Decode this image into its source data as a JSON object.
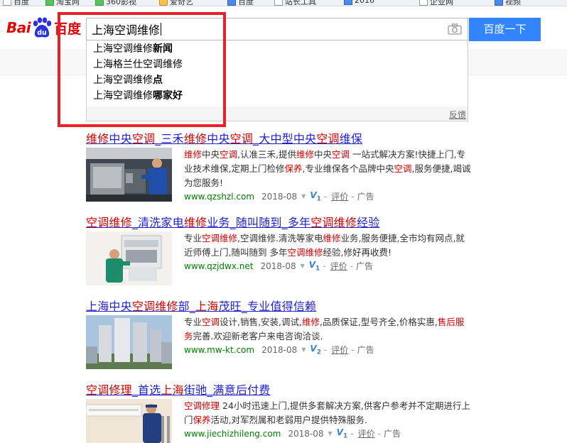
{
  "bookmarks": [
    "百度",
    "淘宝网",
    "360影视",
    "爱奇艺",
    "百度",
    "站长工具",
    "2016",
    "企业网",
    "视频"
  ],
  "logo": {
    "text_left": "Bai",
    "paw_text": "du",
    "text_right": "百度"
  },
  "search": {
    "query": "上海空调维修",
    "button_label": "百度一下"
  },
  "suggestions": [
    {
      "prefix": "上海空调维修",
      "bold": "新闻"
    },
    {
      "prefix": "上海格兰仕空调维修",
      "bold": ""
    },
    {
      "prefix": "上海空调维修",
      "bold": "点"
    },
    {
      "prefix": "上海空调维修",
      "bold": "哪家好"
    }
  ],
  "suggest_feedback": "反馈",
  "results": [
    {
      "title": [
        [
          "维修",
          1
        ],
        [
          "中央",
          0
        ],
        [
          "空调",
          1
        ],
        [
          "_三禾",
          0
        ],
        [
          "维修",
          1
        ],
        [
          "中央",
          0
        ],
        [
          "空调",
          1
        ],
        [
          "_大中型中央",
          0
        ],
        [
          "空调",
          1
        ],
        [
          "维保",
          0
        ]
      ],
      "abstract": [
        [
          "维修",
          1
        ],
        [
          "中央",
          0
        ],
        [
          "空调",
          1
        ],
        [
          ",认准三禾,提供",
          0
        ],
        [
          "维修",
          1
        ],
        [
          "中央",
          0
        ],
        [
          "空调",
          1
        ],
        [
          " 一站式解决方案!快捷上门,专业技术维保,定期上门检修",
          0
        ],
        [
          "保养",
          1
        ],
        [
          ",专业维保各个品牌中央",
          0
        ],
        [
          "空调",
          1
        ],
        [
          ",服务便捷,竭诚为您服务!",
          0
        ]
      ],
      "url": "www.qzshzl.com",
      "date": "2018-08",
      "v_level": "1",
      "eval": "评价",
      "ad": "广告"
    },
    {
      "title": [
        [
          "空调维修",
          1
        ],
        [
          "_清洗家电",
          0
        ],
        [
          "维修",
          1
        ],
        [
          "业务_随叫随到_多年",
          0
        ],
        [
          "空调维修",
          1
        ],
        [
          "经验",
          0
        ]
      ],
      "abstract": [
        [
          "专业",
          0
        ],
        [
          "空调维修",
          1
        ],
        [
          ",空调维修.清洗等家电",
          0
        ],
        [
          "维修",
          1
        ],
        [
          "业务,服务便捷,全市均有网点,就近师傅上门,随叫随到 多年",
          0
        ],
        [
          "空调维修",
          1
        ],
        [
          "经验,修好再收费!",
          0
        ]
      ],
      "url": "www.qzjdwx.net",
      "date": "2018-08",
      "v_level": "1",
      "eval": "评价",
      "ad": "广告"
    },
    {
      "title": [
        [
          "上海中央",
          0
        ],
        [
          "空调维修",
          1
        ],
        [
          "部_",
          0
        ],
        [
          "上海",
          1
        ],
        [
          "茂旺_专业值得信赖",
          0
        ]
      ],
      "abstract": [
        [
          "专业",
          0
        ],
        [
          "空调",
          1
        ],
        [
          "设计,销售,安装,调试,",
          0
        ],
        [
          "维修",
          1
        ],
        [
          ",品质保证,型号齐全,价格实惠,",
          0
        ],
        [
          "售后服务",
          1
        ],
        [
          "完善.欢迎新老客户来电咨询洽谈.",
          0
        ]
      ],
      "url": "www.mw-kt.com",
      "date": "2018-08",
      "v_level": "2",
      "eval": "评价",
      "ad": "广告"
    },
    {
      "title": [
        [
          "空调修理",
          1
        ],
        [
          "_首选",
          0
        ],
        [
          "上海",
          1
        ],
        [
          "街驰_满意后付费",
          0
        ]
      ],
      "abstract": [
        [
          "空调修理",
          1
        ],
        [
          " 24小时迅速上门,提供多套解决方案,供客户参考并不定期进行上门",
          0
        ],
        [
          "保养",
          1
        ],
        [
          "活动,对军烈属和老弱用户提供特殊服务.",
          0
        ]
      ],
      "url": "www.jiechizhileng.com",
      "date": "2018-08",
      "v_level": "1",
      "eval": "评价",
      "ad": "广告"
    }
  ],
  "colors": {
    "link": "#2222cc",
    "highlight": "#cc0000",
    "url": "#008000",
    "button": "#3385ff",
    "annotation": "#e8202a",
    "logo": "#e10601"
  }
}
